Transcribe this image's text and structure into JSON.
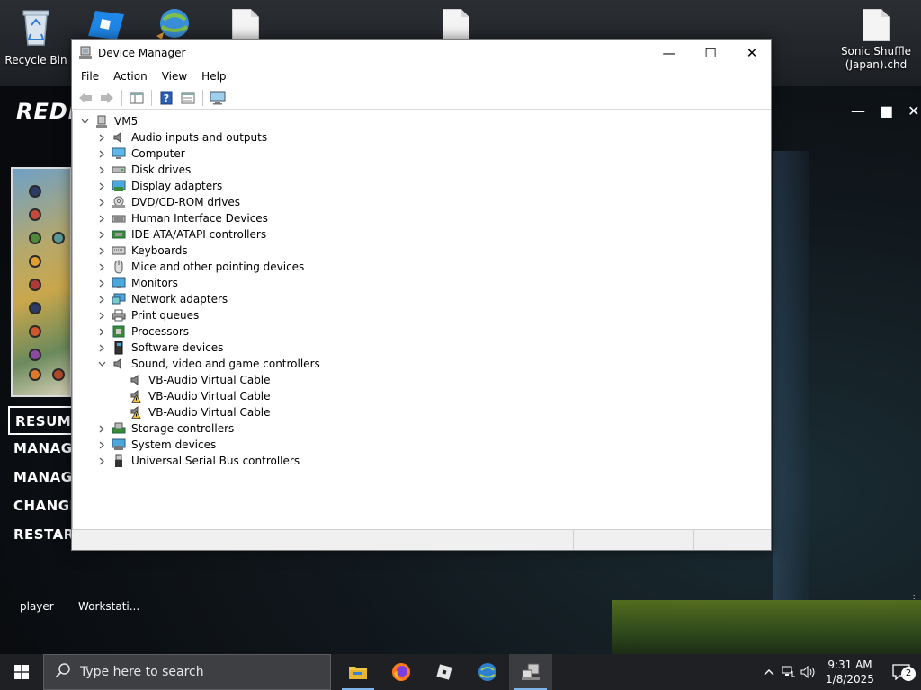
{
  "desktop": {
    "icons": {
      "recycle_bin": "Recycle Bin",
      "sonic_shuffle": "Sonic Shuffle (Japan).chd"
    },
    "background_app": {
      "logo": "REDR",
      "menu": [
        "RESUME",
        "MANAGE",
        "MANAGE",
        "CHANGE",
        "RESTART"
      ],
      "labels": {
        "player": "player",
        "workstation": "Workstati..."
      }
    }
  },
  "window": {
    "title": "Device Manager",
    "controls": {
      "minimize": "—",
      "maximize": "☐",
      "close": "✕"
    },
    "menu": [
      "File",
      "Action",
      "View",
      "Help"
    ],
    "tree": {
      "root": "VM5",
      "categories": [
        {
          "label": "Audio inputs and outputs",
          "icon": "speaker-icon"
        },
        {
          "label": "Computer",
          "icon": "computer-icon"
        },
        {
          "label": "Disk drives",
          "icon": "disk-drive-icon"
        },
        {
          "label": "Display adapters",
          "icon": "display-adapter-icon"
        },
        {
          "label": "DVD/CD-ROM drives",
          "icon": "dvd-drive-icon"
        },
        {
          "label": "Human Interface Devices",
          "icon": "hid-icon"
        },
        {
          "label": "IDE ATA/ATAPI controllers",
          "icon": "ide-controller-icon"
        },
        {
          "label": "Keyboards",
          "icon": "keyboard-icon"
        },
        {
          "label": "Mice and other pointing devices",
          "icon": "mouse-icon"
        },
        {
          "label": "Monitors",
          "icon": "monitor-icon"
        },
        {
          "label": "Network adapters",
          "icon": "network-adapter-icon"
        },
        {
          "label": "Print queues",
          "icon": "printer-icon"
        },
        {
          "label": "Processors",
          "icon": "processor-icon"
        },
        {
          "label": "Software devices",
          "icon": "software-device-icon"
        },
        {
          "label": "Sound, video and game controllers",
          "icon": "speaker-icon",
          "expanded": true,
          "children": [
            {
              "label": "VB-Audio Virtual Cable",
              "warning": false
            },
            {
              "label": "VB-Audio Virtual Cable",
              "warning": true
            },
            {
              "label": "VB-Audio Virtual Cable",
              "warning": true
            }
          ]
        },
        {
          "label": "Storage controllers",
          "icon": "storage-controller-icon"
        },
        {
          "label": "System devices",
          "icon": "system-device-icon"
        },
        {
          "label": "Universal Serial Bus controllers",
          "icon": "usb-icon"
        }
      ]
    }
  },
  "taskbar": {
    "search_placeholder": "Type here to search",
    "clock": {
      "time": "9:31 AM",
      "date": "1/8/2025"
    },
    "notification_count": "2"
  }
}
